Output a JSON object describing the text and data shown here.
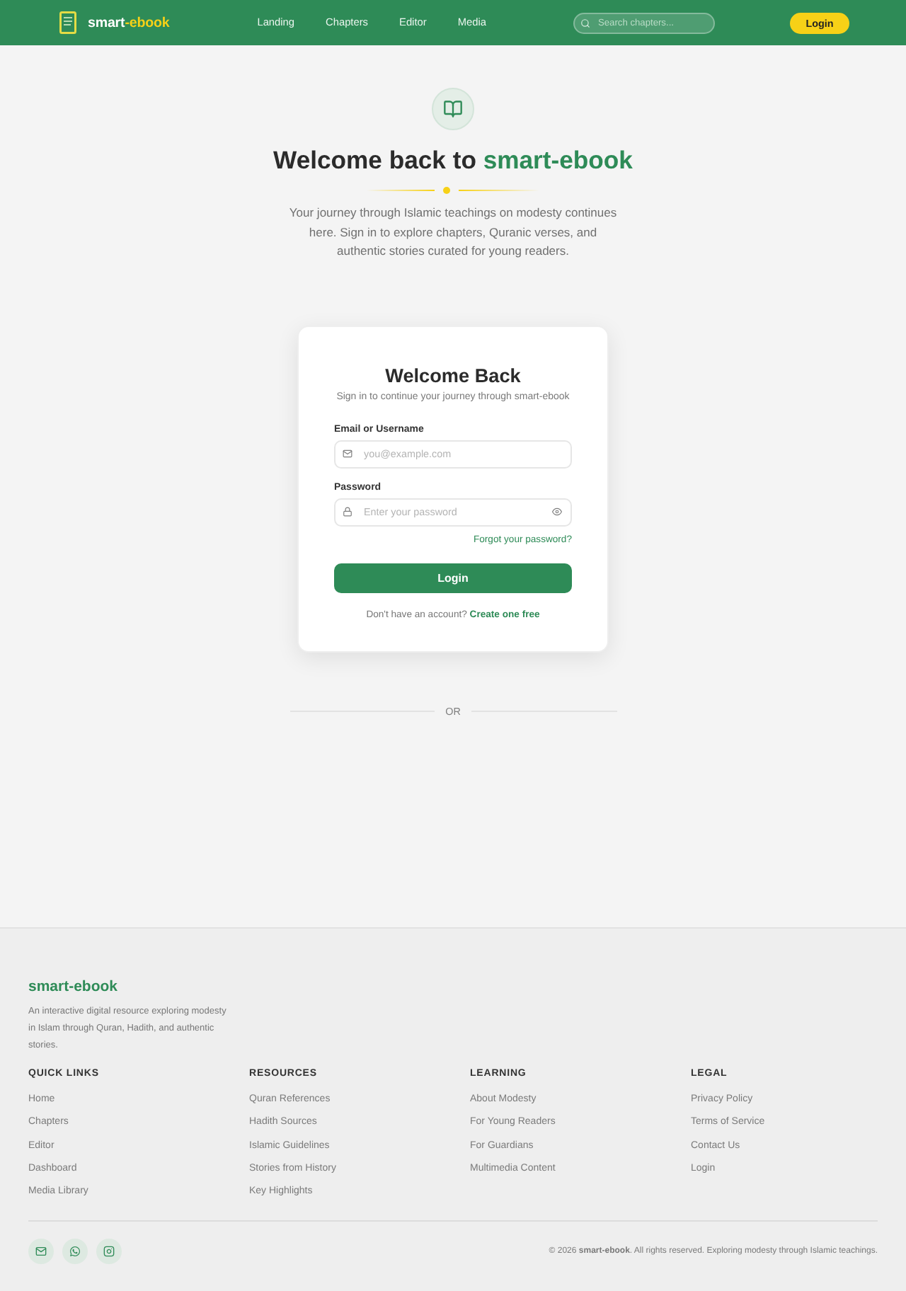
{
  "navbar": {
    "brand": {
      "name": "smart",
      "name_accent": "-ebook"
    },
    "links": [
      "Landing",
      "Chapters",
      "Editor",
      "Media"
    ],
    "search": {
      "placeholder": "Search chapters..."
    },
    "login_button": "Login"
  },
  "hero": {
    "title": "Welcome back to",
    "title_highlight": "smart-ebook",
    "description": "Your journey through Islamic teachings on modesty continues here. Sign in to explore chapters, Quranic verses, and authentic stories curated for young readers."
  },
  "login_card": {
    "title": "Welcome Back",
    "subtitle": "Sign in to continue your journey through smart-ebook",
    "fields": [
      {
        "kind": "email",
        "label": "Email or Username",
        "placeholder": "you@example.com"
      },
      {
        "kind": "password",
        "label": "Password",
        "placeholder": "Enter your password"
      }
    ],
    "forgot_link": "Forgot your password?",
    "submit_button": "Login",
    "signup_prompt": "Don't have an account?",
    "signup_link": "Create one free"
  },
  "divider_label": "OR",
  "footer": {
    "brand": "smart-ebook",
    "description": "An interactive digital resource exploring modesty in Islam through Quran, Hadith, and authentic stories.",
    "columns": [
      {
        "heading": "QUICK LINKS",
        "links": [
          "Home",
          "Chapters",
          "Editor",
          "Dashboard",
          "Media Library"
        ]
      },
      {
        "heading": "RESOURCES",
        "links": [
          "Quran References",
          "Hadith Sources",
          "Islamic Guidelines",
          "Stories from History",
          "Key Highlights"
        ]
      },
      {
        "heading": "LEARNING",
        "links": [
          "About Modesty",
          "For Young Readers",
          "For Guardians",
          "Multimedia Content"
        ]
      },
      {
        "heading": "LEGAL",
        "links": [
          "Privacy Policy",
          "Terms of Service",
          "Contact Us",
          "Login"
        ]
      }
    ],
    "copyright": "© 2026 **smart-ebook**. All rights reserved. Exploring modesty through Islamic teachings."
  }
}
